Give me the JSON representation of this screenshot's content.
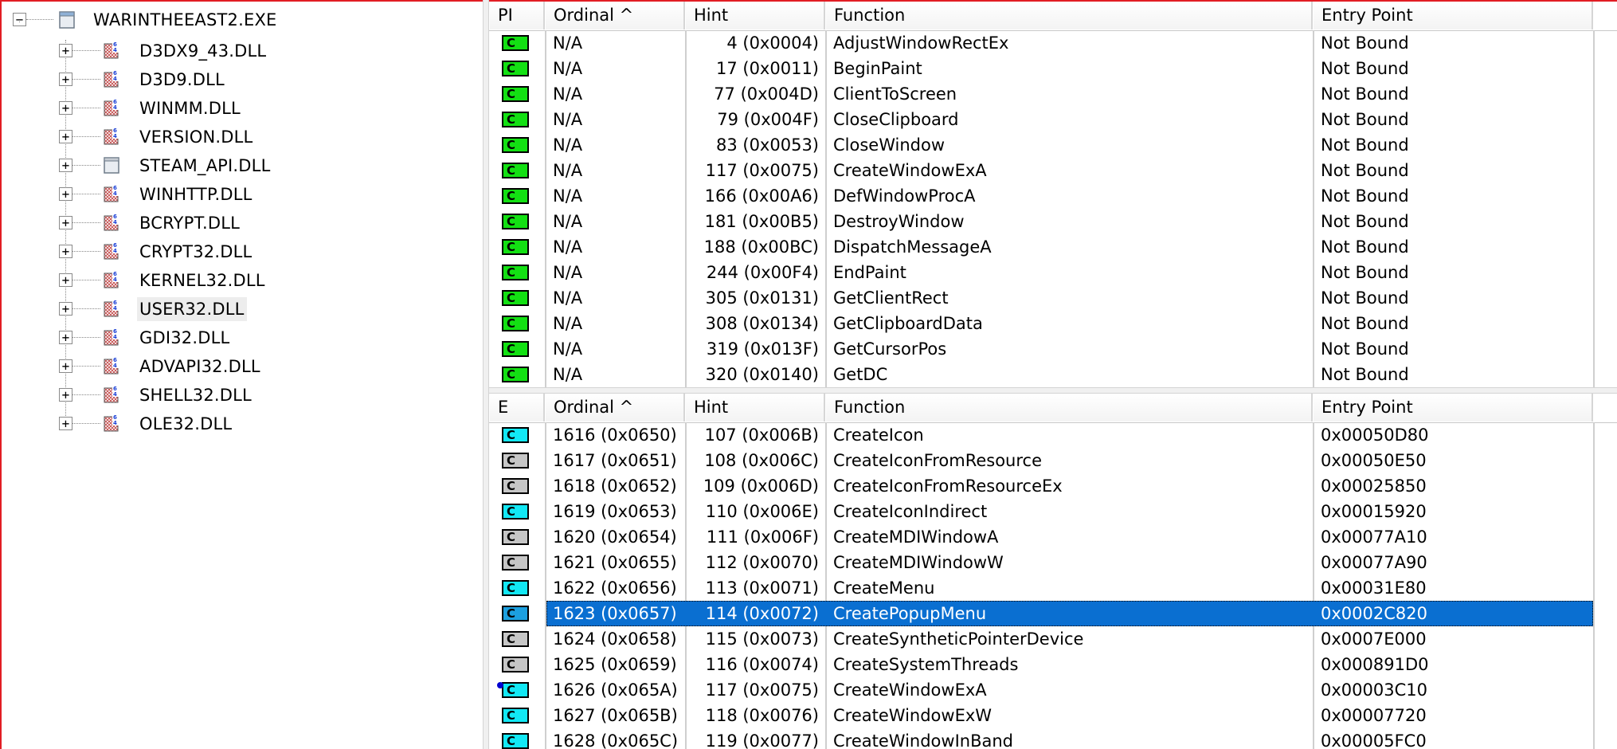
{
  "tree": {
    "root": {
      "label": "WARINTHEEAST2.EXE",
      "expander": "−"
    },
    "items": [
      {
        "label": "D3DX9_43.DLL",
        "icon": "module-64-icon",
        "expander": "+"
      },
      {
        "label": "D3D9.DLL",
        "icon": "module-64-icon",
        "expander": "+"
      },
      {
        "label": "WINMM.DLL",
        "icon": "module-64-icon",
        "expander": "+"
      },
      {
        "label": "VERSION.DLL",
        "icon": "module-64-icon",
        "expander": "+"
      },
      {
        "label": "STEAM_API.DLL",
        "icon": "module-plain-icon",
        "expander": "+"
      },
      {
        "label": "WINHTTP.DLL",
        "icon": "module-64-icon",
        "expander": "+"
      },
      {
        "label": "BCRYPT.DLL",
        "icon": "module-64-icon",
        "expander": "+"
      },
      {
        "label": "CRYPT32.DLL",
        "icon": "module-64-icon",
        "expander": "+"
      },
      {
        "label": "KERNEL32.DLL",
        "icon": "module-64-icon",
        "expander": "+"
      },
      {
        "label": "USER32.DLL",
        "icon": "module-64-icon",
        "expander": "+",
        "selected": true
      },
      {
        "label": "GDI32.DLL",
        "icon": "module-64-icon",
        "expander": "+"
      },
      {
        "label": "ADVAPI32.DLL",
        "icon": "module-64-icon",
        "expander": "+"
      },
      {
        "label": "SHELL32.DLL",
        "icon": "module-64-icon",
        "expander": "+"
      },
      {
        "label": "OLE32.DLL",
        "icon": "module-64-icon",
        "expander": "+"
      }
    ]
  },
  "imports": {
    "columns": [
      "PI",
      "Ordinal ^",
      "Hint",
      "Function",
      "Entry Point"
    ],
    "badge_text": "C",
    "rows": [
      {
        "ordinal": "N/A",
        "hint": "4 (0x0004)",
        "function": "AdjustWindowRectEx",
        "entry": "Not Bound",
        "badge": "green"
      },
      {
        "ordinal": "N/A",
        "hint": "17 (0x0011)",
        "function": "BeginPaint",
        "entry": "Not Bound",
        "badge": "green"
      },
      {
        "ordinal": "N/A",
        "hint": "77 (0x004D)",
        "function": "ClientToScreen",
        "entry": "Not Bound",
        "badge": "green"
      },
      {
        "ordinal": "N/A",
        "hint": "79 (0x004F)",
        "function": "CloseClipboard",
        "entry": "Not Bound",
        "badge": "green"
      },
      {
        "ordinal": "N/A",
        "hint": "83 (0x0053)",
        "function": "CloseWindow",
        "entry": "Not Bound",
        "badge": "green"
      },
      {
        "ordinal": "N/A",
        "hint": "117 (0x0075)",
        "function": "CreateWindowExA",
        "entry": "Not Bound",
        "badge": "green"
      },
      {
        "ordinal": "N/A",
        "hint": "166 (0x00A6)",
        "function": "DefWindowProcA",
        "entry": "Not Bound",
        "badge": "green"
      },
      {
        "ordinal": "N/A",
        "hint": "181 (0x00B5)",
        "function": "DestroyWindow",
        "entry": "Not Bound",
        "badge": "green"
      },
      {
        "ordinal": "N/A",
        "hint": "188 (0x00BC)",
        "function": "DispatchMessageA",
        "entry": "Not Bound",
        "badge": "green"
      },
      {
        "ordinal": "N/A",
        "hint": "244 (0x00F4)",
        "function": "EndPaint",
        "entry": "Not Bound",
        "badge": "green"
      },
      {
        "ordinal": "N/A",
        "hint": "305 (0x0131)",
        "function": "GetClientRect",
        "entry": "Not Bound",
        "badge": "green"
      },
      {
        "ordinal": "N/A",
        "hint": "308 (0x0134)",
        "function": "GetClipboardData",
        "entry": "Not Bound",
        "badge": "green"
      },
      {
        "ordinal": "N/A",
        "hint": "319 (0x013F)",
        "function": "GetCursorPos",
        "entry": "Not Bound",
        "badge": "green"
      },
      {
        "ordinal": "N/A",
        "hint": "320 (0x0140)",
        "function": "GetDC",
        "entry": "Not Bound",
        "badge": "green"
      }
    ]
  },
  "exports": {
    "columns": [
      "E",
      "Ordinal ^",
      "Hint",
      "Function",
      "Entry Point"
    ],
    "badge_text": "C",
    "rows": [
      {
        "ordinal": "1616 (0x0650)",
        "hint": "107 (0x006B)",
        "function": "CreateIcon",
        "entry": "0x00050D80",
        "badge": "cyan"
      },
      {
        "ordinal": "1617 (0x0651)",
        "hint": "108 (0x006C)",
        "function": "CreateIconFromResource",
        "entry": "0x00050E50",
        "badge": "gray"
      },
      {
        "ordinal": "1618 (0x0652)",
        "hint": "109 (0x006D)",
        "function": "CreateIconFromResourceEx",
        "entry": "0x00025850",
        "badge": "gray"
      },
      {
        "ordinal": "1619 (0x0653)",
        "hint": "110 (0x006E)",
        "function": "CreateIconIndirect",
        "entry": "0x00015920",
        "badge": "cyan"
      },
      {
        "ordinal": "1620 (0x0654)",
        "hint": "111 (0x006F)",
        "function": "CreateMDIWindowA",
        "entry": "0x00077A10",
        "badge": "gray"
      },
      {
        "ordinal": "1621 (0x0655)",
        "hint": "112 (0x0070)",
        "function": "CreateMDIWindowW",
        "entry": "0x00077A90",
        "badge": "gray"
      },
      {
        "ordinal": "1622 (0x0656)",
        "hint": "113 (0x0071)",
        "function": "CreateMenu",
        "entry": "0x00031E80",
        "badge": "cyan"
      },
      {
        "ordinal": "1623 (0x0657)",
        "hint": "114 (0x0072)",
        "function": "CreatePopupMenu",
        "entry": "0x0002C820",
        "badge": "blue",
        "selected": true
      },
      {
        "ordinal": "1624 (0x0658)",
        "hint": "115 (0x0073)",
        "function": "CreateSyntheticPointerDevice",
        "entry": "0x0007E000",
        "badge": "gray"
      },
      {
        "ordinal": "1625 (0x0659)",
        "hint": "116 (0x0074)",
        "function": "CreateSystemThreads",
        "entry": "0x000891D0",
        "badge": "gray"
      },
      {
        "ordinal": "1626 (0x065A)",
        "hint": "117 (0x0075)",
        "function": "CreateWindowExA",
        "entry": "0x00003C10",
        "badge": "cyan",
        "dot": true
      },
      {
        "ordinal": "1627 (0x065B)",
        "hint": "118 (0x0076)",
        "function": "CreateWindowExW",
        "entry": "0x00007720",
        "badge": "cyan"
      },
      {
        "ordinal": "1628 (0x065C)",
        "hint": "119 (0x0077)",
        "function": "CreateWindowInBand",
        "entry": "0x00005FC0",
        "badge": "cyan"
      }
    ]
  }
}
